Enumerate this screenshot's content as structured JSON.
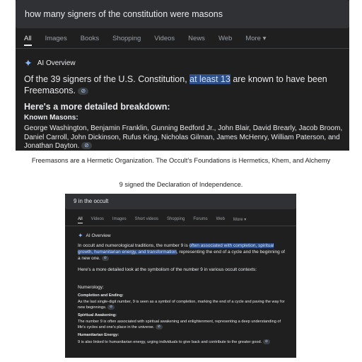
{
  "screenshot1": {
    "query": "how many signers of the constitution were masons",
    "tabs": [
      "All",
      "Images",
      "Books",
      "Shopping",
      "Videos",
      "News",
      "Web",
      "More ▾"
    ],
    "ai_label": "AI Overview",
    "lead_before": "Of the 39 signers of the U.S. Constitution, ",
    "lead_highlight": "at least 13",
    "lead_after": " are known to have been Freemasons.",
    "breakdown_heading": "Here's a more detailed breakdown:",
    "known_masons_label": "Known Masons:",
    "names": "George Washington, Benjamin Franklin, Gunning Bedford Jr., John Blair, David Brearly, Jacob Broom, Daniel Carroll, John Dickinson, Rufus King, Nicholas Gilman, James McHenry, William Paterson, and Jonathan Dayton.",
    "link_glyph": "⊘"
  },
  "captions": {
    "line1": "Freemasons are a Hermetic Organization. The Occult’s Foundations is Hermetics, Khem, and Alchemy",
    "line2": "9 signed the Declaration of Independence."
  },
  "screenshot2": {
    "query": "9 in the occult",
    "tabs": [
      "All",
      "Videos",
      "Images",
      "Short videos",
      "Shopping",
      "Forums",
      "Web",
      "More ▾"
    ],
    "ai_label": "AI Overview",
    "intro_before": "In occult and numerological traditions, the number 9 is ",
    "intro_highlight": "often associated with completion, spiritual growth, humanitarian energy, and transformation",
    "intro_after": ", representing the end of a cycle and the beginning of a new one.",
    "more_detail": "Here's a more detailed look at the symbolism of the number 9 in various occult contexts:",
    "numerology_label": "Numerology:",
    "item1_heading": "Completion and Ending:",
    "item1_body": "As the last single-digit number, 9 is seen as a symbol of completion, marking the end of a cycle and paving the way for new beginnings.",
    "item2_heading": "Spiritual Awakening:",
    "item2_body": "The number 9 is often associated with spiritual awakening and enlightenment, representing a deep understanding of life's cycles and one's place in the universe.",
    "item3_heading": "Humanitarian Energy:",
    "item3_body": "9 is also linked to humanitarian energy, urging individuals to give back and contribute to the greater good.",
    "link_glyph": "⊘"
  },
  "colors": {
    "background": "#1f1f1f",
    "search_bar": "#303134",
    "highlight": "#2f4f8a",
    "sparkle": "#8ab4f8"
  }
}
